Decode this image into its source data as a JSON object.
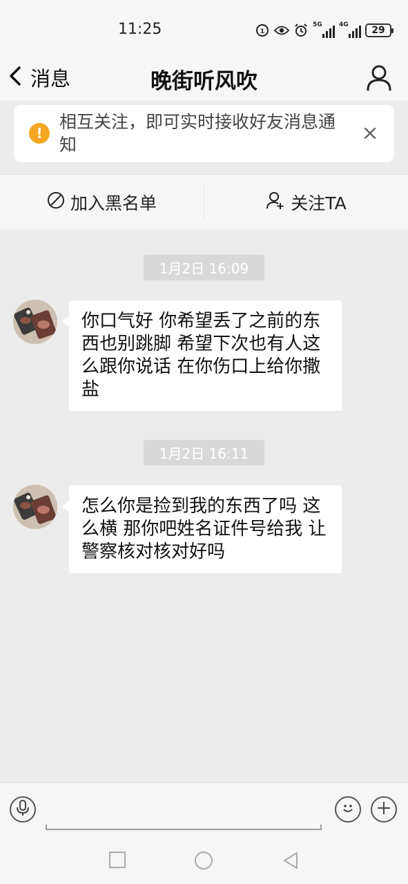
{
  "status_bar": {
    "time": "11:25",
    "network_5g": "5G",
    "network_4g": "4G",
    "battery": "29"
  },
  "nav": {
    "back_label": "消息",
    "title": "晚街听风吹"
  },
  "notice": {
    "text": "相互关注，即可实时接收好友消息通知"
  },
  "actions": {
    "blacklist_label": "加入黑名单",
    "follow_label": "关注TA"
  },
  "messages": [
    {
      "time": "1月2日 16:09",
      "text": "你口气好 你希望丢了之前的东西也别跳脚 希望下次也有人这么跟你说话 在你伤口上给你撒盐"
    },
    {
      "time": "1月2日 16:11",
      "text": "怎么你是捡到我的东西了吗 这么横 那你吧姓名证件号给我 让警察核对核对好吗"
    }
  ],
  "input": {
    "placeholder": ""
  },
  "colors": {
    "background": "#ececec",
    "bar": "#f6f6f6",
    "bubble": "#ffffff",
    "notice_icon": "#f5a623",
    "time_chip": "#d9d9d9"
  },
  "icons": [
    "back-chevron-icon",
    "person-icon",
    "alert-icon",
    "close-icon",
    "block-icon",
    "add-person-icon",
    "microphone-icon",
    "emoji-icon",
    "plus-icon",
    "square-icon",
    "circle-icon",
    "triangle-icon"
  ]
}
